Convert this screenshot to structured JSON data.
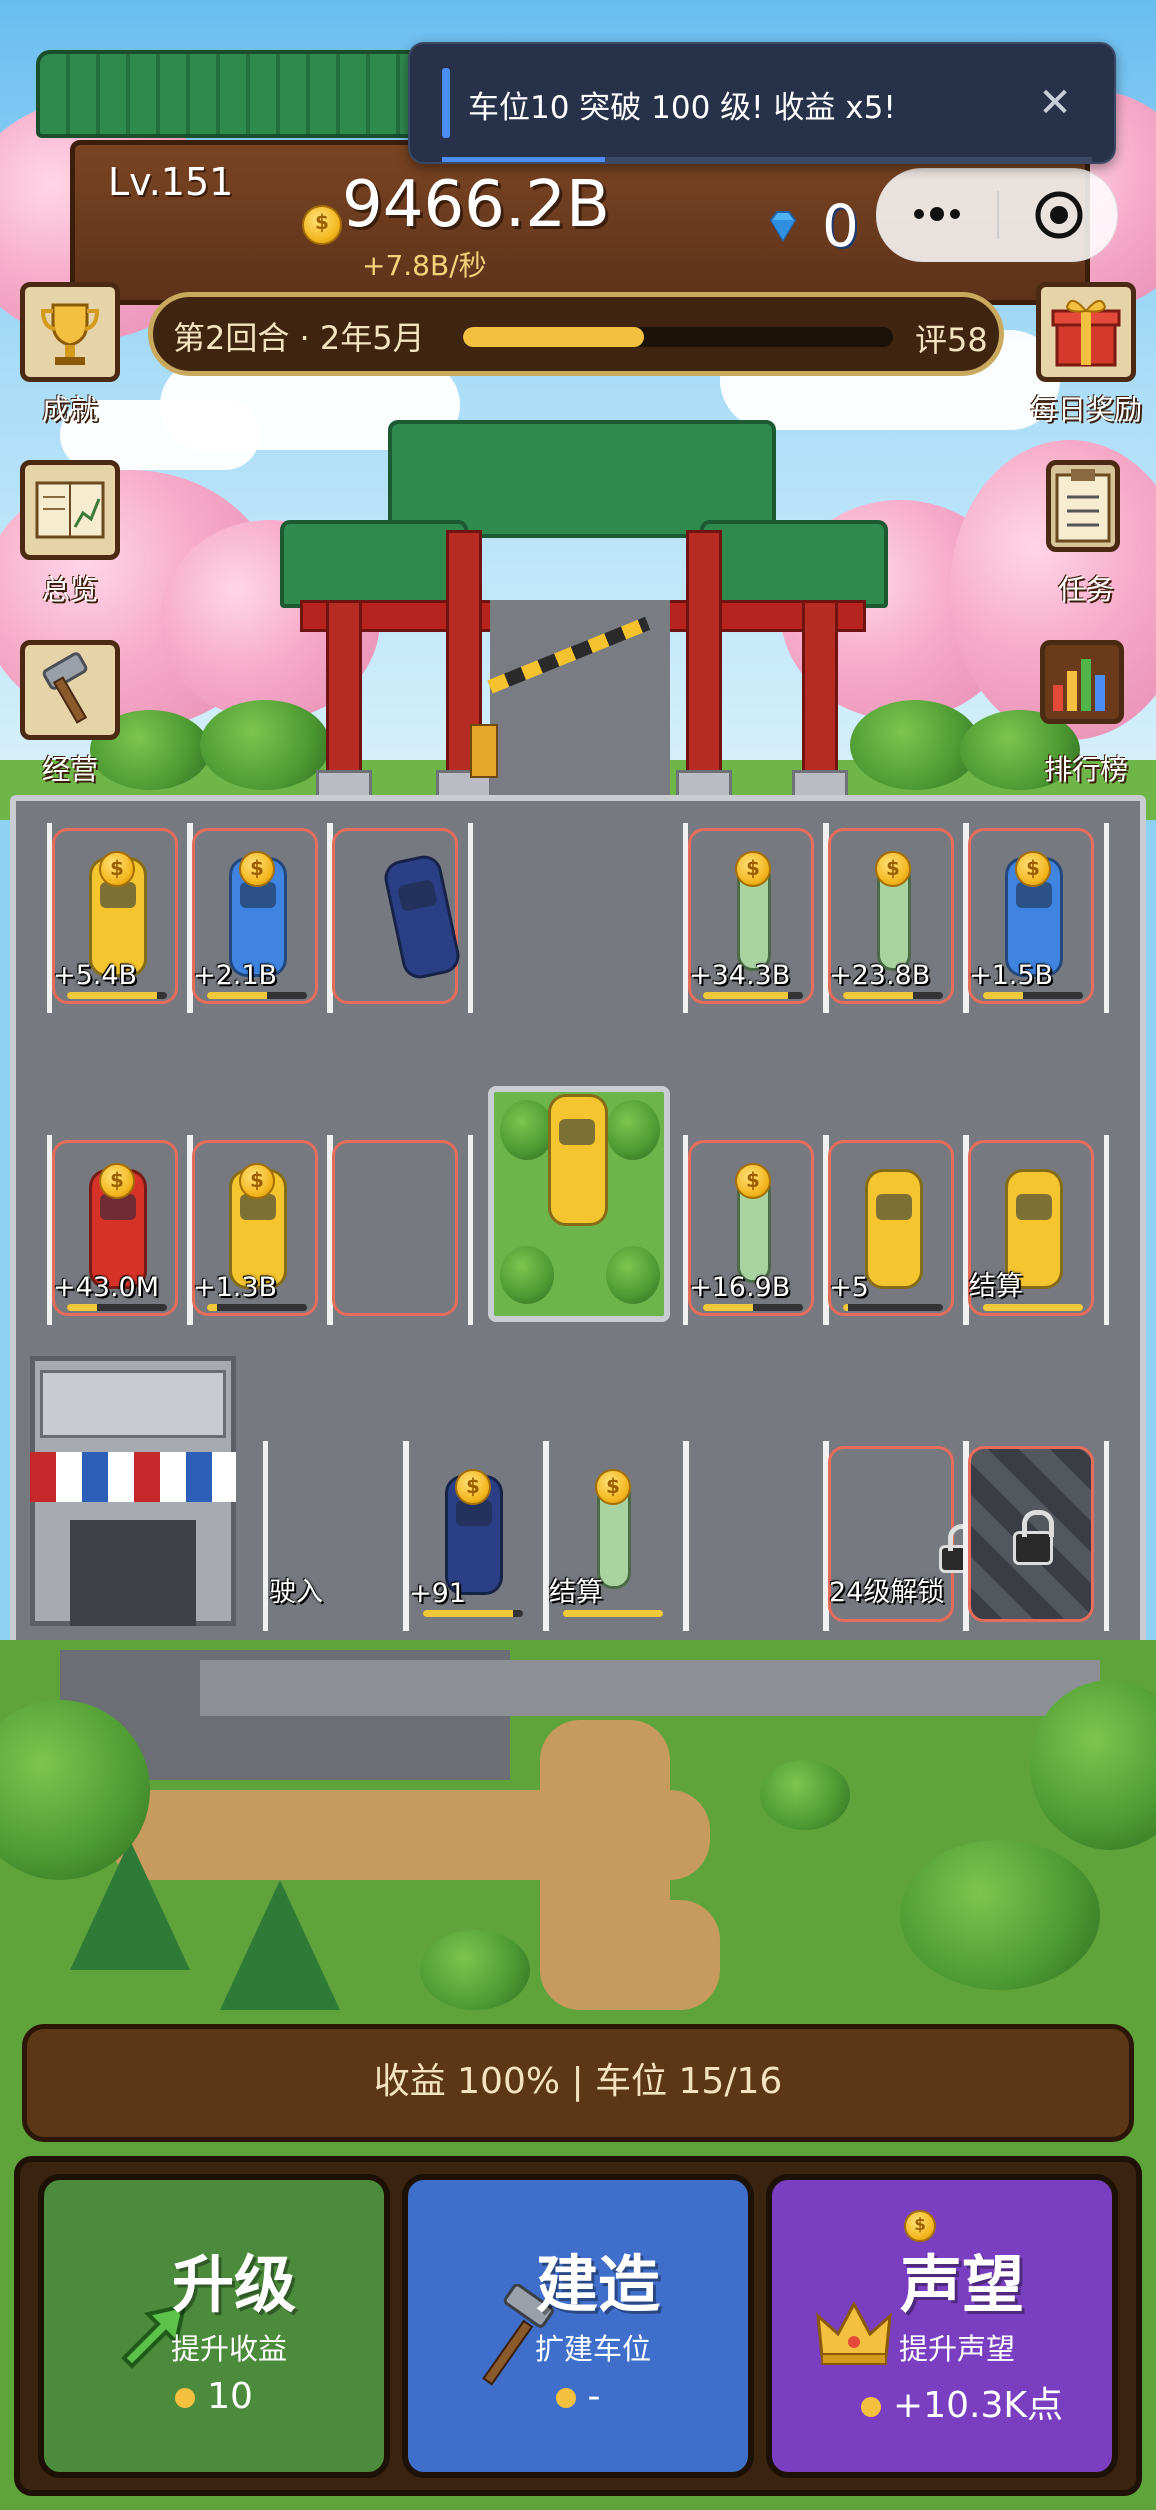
{
  "hud": {
    "level": "Lv.151",
    "money": "9466.2B",
    "income_rate": "+7.8B/秒",
    "gems": "0"
  },
  "notification": {
    "text": "车位10 突破 100 级! 收益 x5!",
    "close_icon": "close-icon",
    "progress": 0.25
  },
  "capsule": {
    "more_icon": "more-icon",
    "target_icon": "target-icon"
  },
  "round": {
    "label": "第2回合 · 2年5月",
    "progress": 0.42,
    "rating": "评58"
  },
  "side_left": [
    {
      "label": "成就",
      "icon": "trophy-icon"
    },
    {
      "label": "总览",
      "icon": "overview-chart-icon"
    },
    {
      "label": "经营",
      "icon": "hammer-icon"
    }
  ],
  "side_right": [
    {
      "label": "每日奖励",
      "icon": "gift-icon"
    },
    {
      "label": "任务",
      "icon": "clipboard-icon"
    },
    {
      "label": "排行榜",
      "icon": "bar-chart-icon"
    }
  ],
  "parking": {
    "row1_left": [
      {
        "label": "+5.4B",
        "vehicle": "yellow-taxi",
        "progress": 0.9,
        "coin": true
      },
      {
        "label": "+2.1B",
        "vehicle": "blue-car",
        "progress": 0.6,
        "coin": true
      },
      {
        "label": "",
        "vehicle": "dark-blue-van",
        "progress": 0,
        "coin": false
      }
    ],
    "row1_right": [
      {
        "label": "+34.3B",
        "vehicle": "green-scooter",
        "progress": 0.85,
        "coin": true
      },
      {
        "label": "+23.8B",
        "vehicle": "green-scooter",
        "progress": 0.7,
        "coin": true
      },
      {
        "label": "+1.5B",
        "vehicle": "blue-car",
        "progress": 0.4,
        "coin": true
      }
    ],
    "center_taxi": "yellow-taxi",
    "row2_left": [
      {
        "label": "+43.0M",
        "vehicle": "red-car",
        "progress": 0.3,
        "coin": true
      },
      {
        "label": "+1.3B",
        "vehicle": "yellow-taxi",
        "progress": 0.1,
        "coin": true
      },
      {
        "label": "",
        "vehicle": "",
        "progress": 0,
        "coin": false
      }
    ],
    "row2_right": [
      {
        "label": "+16.9B",
        "vehicle": "green-scooter",
        "progress": 0.5,
        "coin": true
      },
      {
        "label": "+5",
        "vehicle": "yellow-taxi",
        "progress": 0.05,
        "coin": false
      },
      {
        "label": "结算",
        "vehicle": "yellow-taxi",
        "progress": 1.0,
        "coin": false
      }
    ],
    "row3": [
      {
        "label": "驶入",
        "vehicle": "",
        "progress": 0
      },
      {
        "label": "+91",
        "vehicle": "dark-blue-van",
        "progress": 0.9,
        "coin": true
      },
      {
        "label": "结算",
        "vehicle": "green-scooter",
        "progress": 1.0,
        "coin": true
      },
      {
        "label": "",
        "vehicle": "",
        "progress": 0
      },
      {
        "label": "24级解锁",
        "vehicle": "",
        "progress": 0,
        "locked_small": true
      },
      {
        "label": "",
        "vehicle": "",
        "progress": 0,
        "locked": true
      }
    ]
  },
  "stats": "收益 100%  |  车位 15/16",
  "actions": [
    {
      "title": "升级",
      "subtitle": "提升收益",
      "cost": "10",
      "icon": "green-arrow-icon",
      "color": "#4b8b3b"
    },
    {
      "title": "建造",
      "subtitle": "扩建车位",
      "cost": "-",
      "icon": "hammer-icon",
      "color": "#3f6fcb"
    },
    {
      "title": "声望",
      "subtitle": "提升声望",
      "cost": "+10.3K点",
      "icon": "crown-icon",
      "color": "#7a3fc0"
    }
  ],
  "colors": {
    "wood_dark": "#3b1e0c",
    "gold": "#f3c13f",
    "slot_border": "#e66c5c"
  }
}
